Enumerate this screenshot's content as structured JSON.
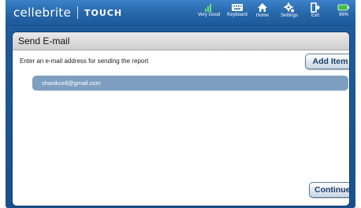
{
  "brand": {
    "name": "cellebrite",
    "product": "TOUCH"
  },
  "topbar": {
    "items": [
      {
        "id": "signal",
        "label": "Very Good",
        "icon": "signal-icon"
      },
      {
        "id": "keyboard",
        "label": "Keyboard",
        "icon": "keyboard-icon"
      },
      {
        "id": "home",
        "label": "Home",
        "icon": "home-icon"
      },
      {
        "id": "settings",
        "label": "Settings",
        "icon": "gear-icon"
      },
      {
        "id": "exit",
        "label": "Exit",
        "icon": "exit-icon"
      },
      {
        "id": "battery",
        "label": "96%",
        "icon": "battery-icon"
      }
    ]
  },
  "panel": {
    "title": "Send E-mail",
    "instruction": "Enter an e-mail address for sending the report",
    "add_item_label": "Add Item",
    "emails": [
      "shanikcell@gmail.com"
    ],
    "continue_label": "Continue"
  },
  "colors": {
    "frame": "#1f5a9c",
    "selected_row": "#7f9fc1",
    "button_text": "#1d3e66",
    "battery": "#3fbf3f"
  }
}
